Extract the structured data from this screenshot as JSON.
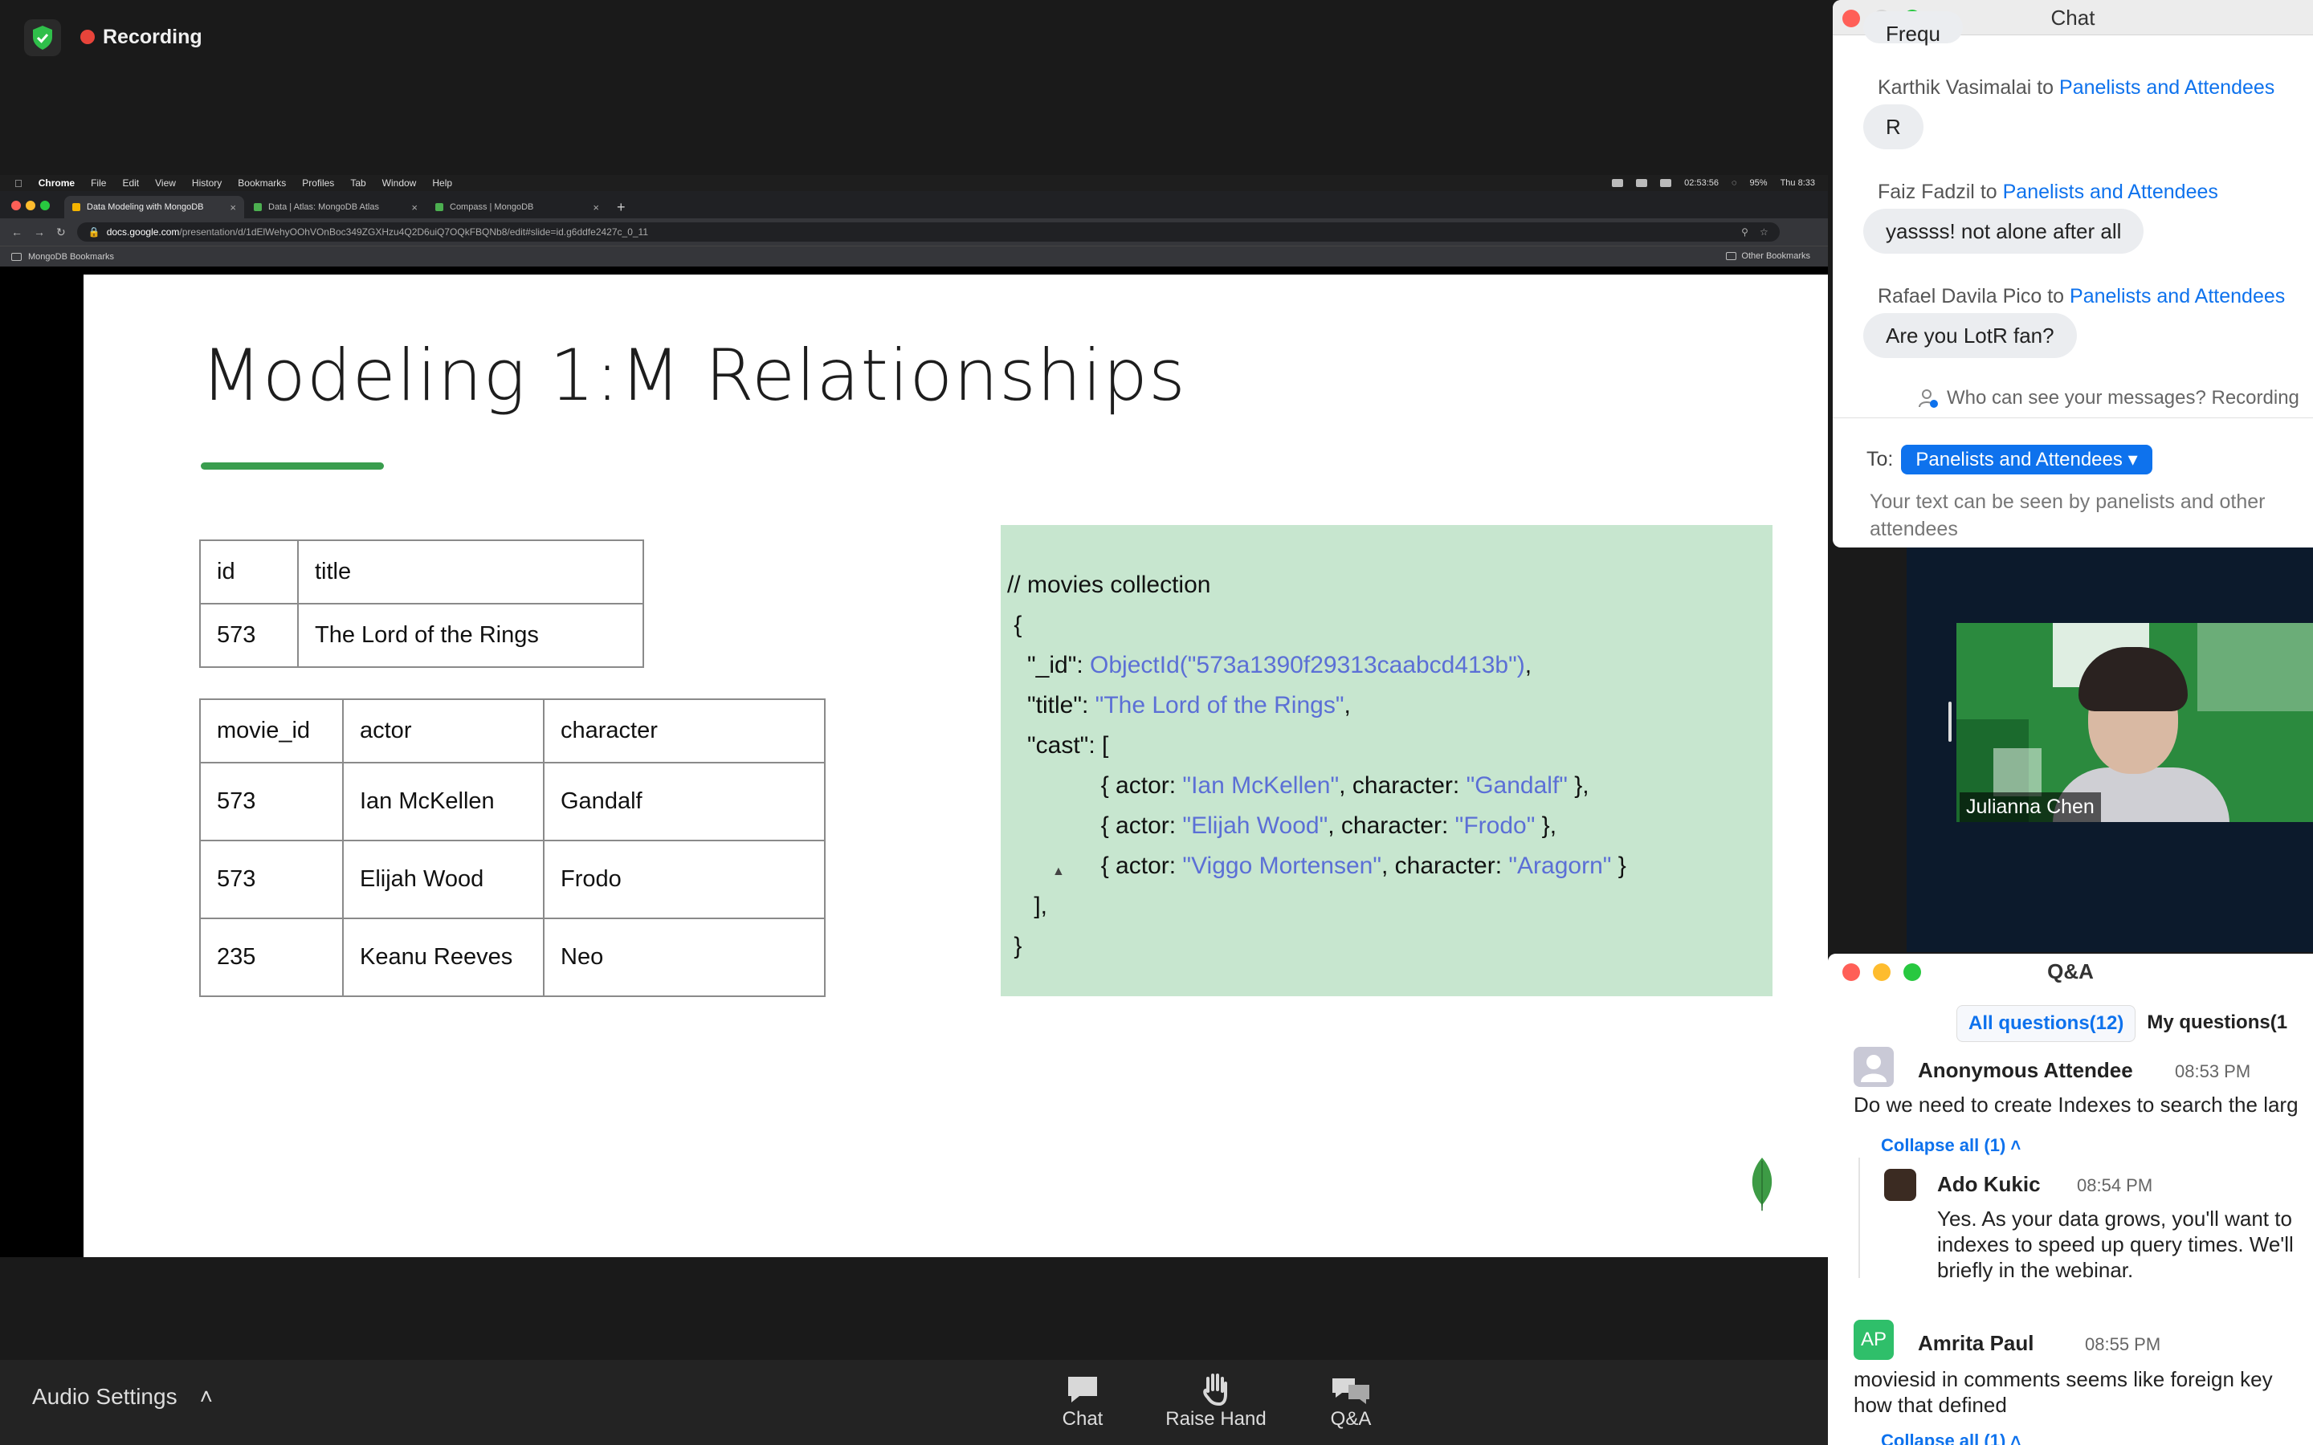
{
  "meeting": {
    "recording_label": "Recording",
    "colors": {
      "recording_dot": "#e8443a",
      "shield": "#2fbf4a",
      "zoom_blue": "#0e72ed"
    }
  },
  "browser": {
    "menubar": {
      "app": "Chrome",
      "items": [
        "File",
        "Edit",
        "View",
        "History",
        "Bookmarks",
        "Profiles",
        "Tab",
        "Window",
        "Help"
      ],
      "clock": "02:53:56",
      "battery": "95%",
      "datetime": "Thu 8:33"
    },
    "tabs": [
      {
        "label": "Data Modeling with MongoDB"
      },
      {
        "label": "Data | Atlas: MongoDB Atlas"
      },
      {
        "label": "Compass | MongoDB"
      }
    ],
    "url_host": "docs.google.com",
    "url_path": "/presentation/d/1dElWehyOOhVOnBoc349ZGXHzu4Q2D6uiQ7OQkFBQNb8/edit#slide=id.g6ddfe2427c_0_11",
    "bookmarks": {
      "left": "MongoDB Bookmarks",
      "right": "Other Bookmarks"
    }
  },
  "slide": {
    "title": "Modeling 1:M Relationships",
    "table1": {
      "headers": [
        "id",
        "title"
      ],
      "rows": [
        [
          "573",
          "The Lord of the Rings"
        ]
      ]
    },
    "table2": {
      "headers": [
        "movie_id",
        "actor",
        "character"
      ],
      "rows": [
        [
          "573",
          "Ian McKellen",
          "Gandalf"
        ],
        [
          "573",
          "Elijah Wood",
          "Frodo"
        ],
        [
          "235",
          "Keanu Reeves",
          "Neo"
        ]
      ]
    },
    "code": {
      "comment": "// movies collection",
      "open_brace": "{",
      "id_key": "\"_id\": ",
      "id_value": "ObjectId(\"573a1390f29313caabcd413b\")",
      "title_key": "\"title\": ",
      "title_value": "\"The Lord of the Rings\"",
      "cast_key": "\"cast\": [",
      "actor_key": "{ actor: ",
      "character_key": ", character: ",
      "cast": [
        {
          "actor": "\"Ian McKellen\"",
          "character": "\"Gandalf\"",
          "end": " },"
        },
        {
          "actor": "\"Elijah Wood\"",
          "character": "\"Frodo\"",
          "end": " },"
        },
        {
          "actor": "\"Viggo Mortensen\"",
          "character": "\"Aragorn\"",
          "end": " }"
        }
      ],
      "close_bracket": "],",
      "close_brace": "}"
    },
    "colors": {
      "underline": "#3a9d4e",
      "code_bg": "#c7e6cf",
      "code_string": "#5b6fd6"
    }
  },
  "chat": {
    "title": "Chat",
    "to_word": " to ",
    "partial_bubble": "Frequ",
    "messages": [
      {
        "sender": "Karthik Vasimalai",
        "target": "Panelists and Attendees",
        "text": "R"
      },
      {
        "sender": "Faiz Fadzil",
        "target": "Panelists and Attendees",
        "text": "yassss! not alone after all"
      },
      {
        "sender": "Rafael Davila Pico",
        "target": "Panelists and Attendees",
        "text": "Are you LotR fan?"
      }
    ],
    "who_can_see": "Who can see your messages? Recording",
    "to_label": "To:",
    "to_value": "Panelists and Attendees",
    "input_placeholder": "Your text can be seen by panelists and other attendees"
  },
  "video": {
    "name": "Julianna Chen"
  },
  "qa": {
    "title": "Q&A",
    "tabs": [
      "All questions(12)",
      "My questions(1"
    ],
    "questions": [
      {
        "name": "Anonymous Attendee",
        "time": "08:53 PM",
        "text": "Do we need to create Indexes to search the larg",
        "collapse": "Collapse all (1)",
        "reply": {
          "name": "Ado Kukic",
          "time": "08:54 PM",
          "lines": [
            "Yes. As your data grows, you'll want to",
            "indexes to speed up query times. We'll",
            "briefly in the webinar."
          ]
        }
      },
      {
        "name": "Amrita Paul",
        "initials": "AP",
        "time": "08:55 PM",
        "lines": [
          "moviesid in comments seems like foreign key",
          "how that defined"
        ],
        "collapse": "Collapse all (1)"
      }
    ]
  },
  "toolbar": {
    "audio_settings": "Audio Settings",
    "buttons": [
      {
        "label": "Chat",
        "icon": "chat-icon"
      },
      {
        "label": "Raise Hand",
        "icon": "raise-hand-icon"
      },
      {
        "label": "Q&A",
        "icon": "qa-icon"
      }
    ]
  }
}
